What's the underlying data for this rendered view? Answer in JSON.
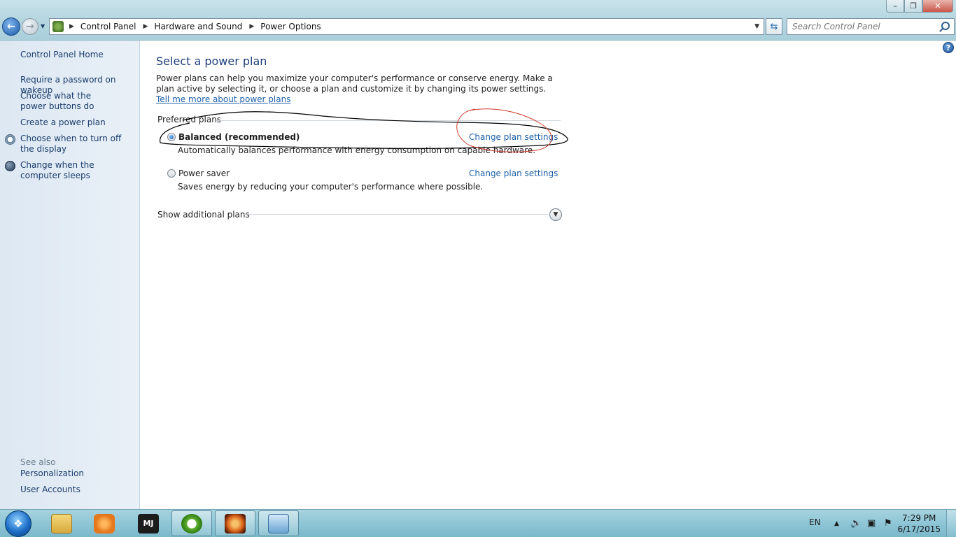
{
  "window": {
    "minimize_glyph": "–",
    "restore_glyph": "❐",
    "close_glyph": "✕"
  },
  "address": {
    "crumbs": [
      "Control Panel",
      "Hardware and Sound",
      "Power Options"
    ],
    "search_placeholder": "Search Control Panel"
  },
  "sidebar": {
    "home": "Control Panel Home",
    "tasks": [
      "Require a password on wakeup",
      "Choose what the power buttons do",
      "Create a power plan",
      "Choose when to turn off the display",
      "Change when the computer sleeps"
    ],
    "see_also_label": "See also",
    "see_also": [
      "Personalization",
      "User Accounts"
    ]
  },
  "main": {
    "title": "Select a power plan",
    "intro_text": "Power plans can help you maximize your computer's performance or conserve energy. Make a plan active by selecting it, or choose a plan and customize it by changing its power settings.",
    "intro_link": "Tell me more about power plans",
    "preferred_label": "Preferred plans",
    "plans": [
      {
        "name": "Balanced (recommended)",
        "description": "Automatically balances performance with energy consumption on capable hardware.",
        "link": "Change plan settings",
        "selected": true
      },
      {
        "name": "Power saver",
        "description": "Saves energy by reducing your computer's performance where possible.",
        "link": "Change plan settings",
        "selected": false
      }
    ],
    "show_additional": "Show additional plans"
  },
  "taskbar": {
    "language": "EN",
    "time": "7:29 PM",
    "date": "6/17/2015",
    "items": [
      "file-explorer-icon",
      "media-player-icon",
      "app-mj-icon",
      "app-green-circle-icon",
      "app-orange-icon",
      "control-panel-icon"
    ]
  },
  "colors": {
    "link": "#1c5fa8",
    "title": "#1e3f7a",
    "annotation_black": "#000000",
    "annotation_red": "#d0392b"
  }
}
